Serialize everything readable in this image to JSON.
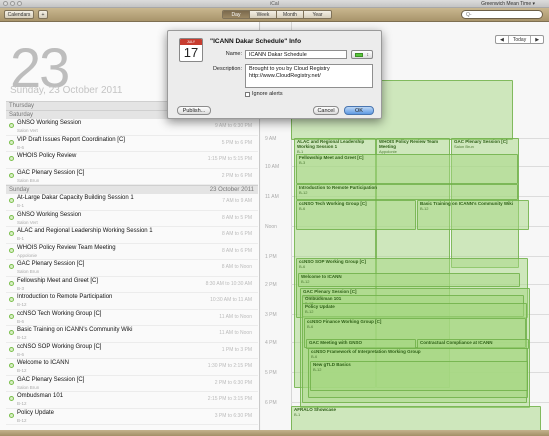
{
  "window": {
    "title": "iCal",
    "timezone": "Greenwich Mean Time ▾"
  },
  "toolbar": {
    "calendars_label": "Calendars",
    "add_label": "+",
    "views": [
      "Day",
      "Week",
      "Month",
      "Year"
    ],
    "active_view": "Day",
    "search_placeholder": "Q-"
  },
  "day_header": {
    "number": "23",
    "date_line": "Sunday, 23 October 2011"
  },
  "nav": {
    "prev": "◀",
    "today": "Today",
    "next": "▶"
  },
  "list": {
    "sections": [
      {
        "label": "Thursday",
        "date": ""
      },
      {
        "label": "Saturday",
        "date": ""
      },
      {
        "label": "Sunday",
        "date": "23 October 2011"
      }
    ],
    "events": [
      {
        "title": "GNSO Working Session",
        "sub": "Salon Vert",
        "time": "9 AM to 6:30 PM"
      },
      {
        "title": "VIP Draft Issues Report Coordination [C]",
        "sub": "B-6",
        "time": "5 PM to 6 PM"
      },
      {
        "title": "WHOIS Policy Review",
        "sub": "",
        "time": "1:15 PM to 5:15 PM"
      },
      {
        "title": "GAC Plenary Session [C]",
        "sub": "Salon Brun",
        "time": "2 PM to 6 PM"
      },
      {
        "title": "At-Large Dakar Capacity Building Session 1",
        "sub": "B-1",
        "time": "7 AM to 9 AM"
      },
      {
        "title": "GNSO Working Session",
        "sub": "Salon Vert",
        "time": "8 AM to 5 PM"
      },
      {
        "title": "ALAC and Regional Leadership Working Session 1",
        "sub": "B-1",
        "time": "8 AM to 6 PM"
      },
      {
        "title": "WHOIS Policy Review Team Meeting",
        "sub": "Appolonie",
        "time": "8 AM to 6 PM"
      },
      {
        "title": "GAC Plenary Session [C]",
        "sub": "Salon Brun",
        "time": "8 AM to Noon"
      },
      {
        "title": "Fellowship Meet and Greet [C]",
        "sub": "B-3",
        "time": "8:30 AM to 10:30 AM"
      },
      {
        "title": "Introduction to Remote Participation",
        "sub": "B-12",
        "time": "10:30 AM to 11 AM"
      },
      {
        "title": "ccNSO Tech Working Group [C]",
        "sub": "B-6",
        "time": "11 AM to Noon"
      },
      {
        "title": "Basic Training on ICANN's Community Wiki",
        "sub": "B-12",
        "time": "11 AM to Noon"
      },
      {
        "title": "ccNSO SOP Working Group [C]",
        "sub": "B-6",
        "time": "1 PM to 3 PM"
      },
      {
        "title": "Welcome to ICANN",
        "sub": "B-12",
        "time": "1:30 PM to 2:15 PM"
      },
      {
        "title": "GAC Plenary Session [C]",
        "sub": "Salon Brun",
        "time": "2 PM to 6:30 PM"
      },
      {
        "title": "Ombudsman 101",
        "sub": "B-12",
        "time": "2:15 PM to 3:15 PM"
      },
      {
        "title": "Policy Update",
        "sub": "B-12",
        "time": "3 PM to 6:30 PM"
      }
    ]
  },
  "hours": [
    "9 AM",
    "10 AM",
    "11 AM",
    "Noon",
    "1 PM",
    "2 PM",
    "3 PM",
    "4 PM",
    "5 PM",
    "6 PM"
  ],
  "grid_events": [
    {
      "title": "ALAC and Regional Leadership Working Session 1",
      "sub": "B-1"
    },
    {
      "title": "WHOIS Policy Review Team Meeting",
      "sub": "Appolonie"
    },
    {
      "title": "GAC Plenary Session [C]",
      "sub": "Salon Brun"
    },
    {
      "title": "Fellowship Meet and Greet [C]",
      "sub": "B-3"
    },
    {
      "title": "Introduction to Remote Participation",
      "sub": "B-12"
    },
    {
      "title": "ccNSO Tech Working Group [C]",
      "sub": "B-6"
    },
    {
      "title": "Basic Training on ICANN's Community Wiki",
      "sub": "B-12"
    },
    {
      "title": "ccNSO SOP Working Group [C]",
      "sub": "B-6"
    },
    {
      "title": "Welcome to ICANN",
      "sub": "B-12"
    },
    {
      "title": "GAC Plenary Session [C]",
      "sub": "Salon Brun"
    },
    {
      "title": "Ombudsman 101",
      "sub": "B-12"
    },
    {
      "title": "Policy Update",
      "sub": "B-12"
    },
    {
      "title": "ccNSO Finance Working Group [C]",
      "sub": "B-6"
    },
    {
      "title": "GAC Meeting with GNSO",
      "sub": ""
    },
    {
      "title": "Contractual Compliance at ICANN",
      "sub": ""
    },
    {
      "title": "ccNSO Framework of Interpretation Working Group",
      "sub": "B-6"
    },
    {
      "title": "New gTLD Basics",
      "sub": "B-12"
    },
    {
      "title": "AFRALO Showcase",
      "sub": "B-1"
    },
    {
      "title": "1",
      "sub": ""
    }
  ],
  "dialog": {
    "title": "\"ICANN Dakar Schedule\" Info",
    "icon_month": "JULY",
    "icon_day": "17",
    "name_label": "Name:",
    "name_value": "ICANN Dakar Schedule",
    "description_label": "Description:",
    "description_line1": "Brought to you by Cloud Registry",
    "description_line2": "http://www.CloudRegistry.net/",
    "ignore_alerts_label": "Ignore alerts",
    "publish_label": "Publish...",
    "cancel_label": "Cancel",
    "ok_label": "OK",
    "color": "#57c73a"
  }
}
